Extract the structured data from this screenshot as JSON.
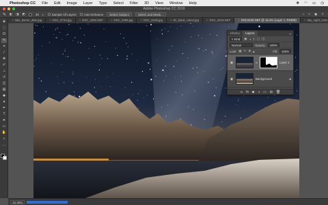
{
  "menubar": {
    "app_name": "Photoshop CC",
    "items": [
      "File",
      "Edit",
      "Image",
      "Layer",
      "Type",
      "Select",
      "Filter",
      "3D",
      "View",
      "Window",
      "Help"
    ],
    "status_icons": [
      "dropbox-icon",
      "wifi-icon",
      "battery-icon",
      "clock-icon"
    ]
  },
  "window": {
    "title": "Adobe Photoshop CC 2019",
    "traffic_colors": [
      "#fc605b",
      "#fdbc40",
      "#34c84a"
    ]
  },
  "options": {
    "brush_size": "30",
    "sample_all_layers": "Sample All Layers",
    "auto_enhance": "Auto-Enhance",
    "select_subject": "Select Subject",
    "select_and_mask": "Select and Mask...",
    "end_icons": [
      "home-icon",
      "search-icon",
      "workspace-icon",
      "share-icon"
    ]
  },
  "tabs": [
    {
      "label": "lake_kanne_after.jpg",
      "active": false
    },
    {
      "label": "DSC_0733.jpg",
      "active": false
    },
    {
      "label": "DSC_4393.NEF",
      "active": false
    },
    {
      "label": "DSC_2396.jpg",
      "active": false
    },
    {
      "label": "DSC_5226.jpg",
      "active": false
    },
    {
      "label": "02_hand_colour.jpg",
      "active": false
    },
    {
      "label": "DSC_4618.NEF",
      "active": false
    },
    {
      "label": "DSC2433.NEF @ 16.4% (Layer 1, RGB/8)",
      "active": true
    },
    {
      "label": "day_night_town",
      "active": false
    }
  ],
  "tools": [
    "move-icon",
    "marquee-icon",
    "lasso-icon",
    "quick-select-icon",
    "crop-icon",
    "eyedropper-icon",
    "heal-icon",
    "brush-icon",
    "stamp-icon",
    "history-brush-icon",
    "eraser-icon",
    "gradient-icon",
    "blur-icon",
    "dodge-icon",
    "pen-icon",
    "type-icon",
    "path-select-icon",
    "rectangle-icon",
    "hand-icon",
    "zoom-icon",
    "more-icon"
  ],
  "colors": {
    "foreground": "#000000",
    "background": "#ffffff"
  },
  "layers_panel": {
    "tabs": [
      {
        "label": "History",
        "active": false
      },
      {
        "label": "Layers",
        "active": true
      }
    ],
    "kind_label": "Kind",
    "blend_mode": "Normal",
    "opacity_label": "Opacity:",
    "opacity_value": "100%",
    "lock_label": "Lock:",
    "fill_label": "Fill:",
    "fill_value": "100%",
    "layers": [
      {
        "name": "Layer 1",
        "selected": true,
        "visible": true,
        "has_mask": true
      },
      {
        "name": "Background",
        "selected": false,
        "visible": true,
        "locked": true
      }
    ],
    "footer_icons": [
      "link-icon",
      "fx-icon",
      "mask-icon",
      "adjustment-icon",
      "group-icon",
      "new-layer-icon",
      "trash-icon"
    ]
  },
  "status": {
    "zoom": "16.38%"
  }
}
